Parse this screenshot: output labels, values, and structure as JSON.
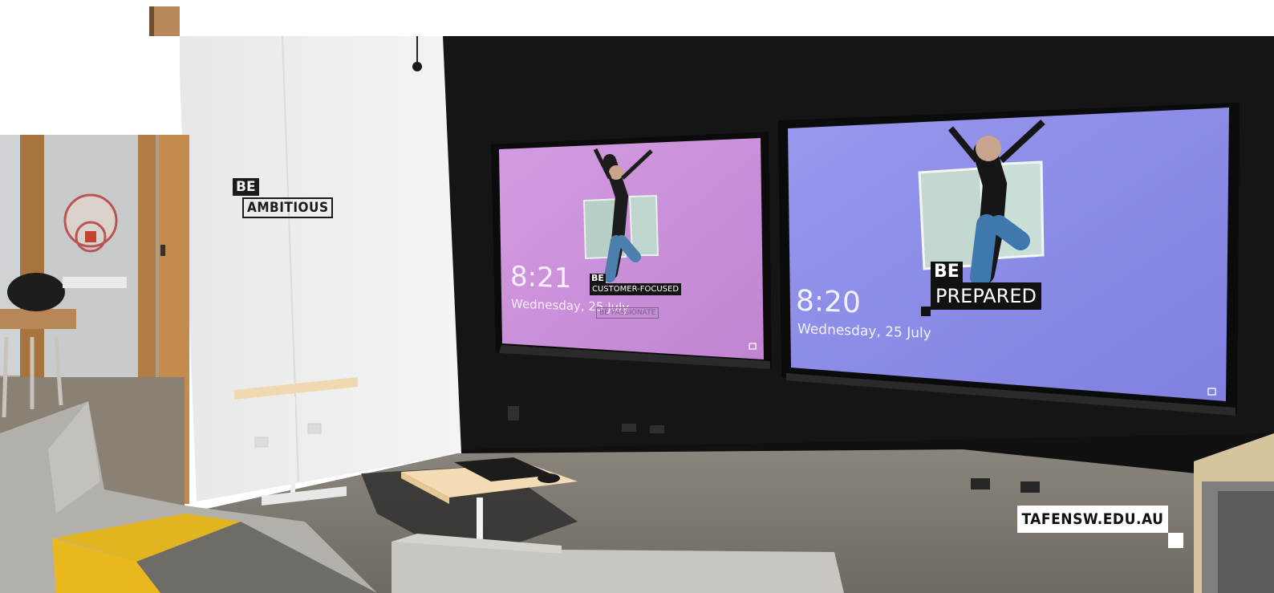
{
  "wall_sign": {
    "line1": "BE",
    "line2": "AMBITIOUS"
  },
  "left_screen": {
    "time": "8:21",
    "date": "Wednesday, 25 July",
    "tag_be": "BE",
    "tag_value": "CUSTOMER-FOCUSED",
    "tag_secondary": "BE PASSIONATE",
    "background_color": "#c98ad6"
  },
  "right_screen": {
    "time": "8:20",
    "date": "Wednesday, 25 July",
    "tag_be": "BE",
    "tag_value": "PREPARED",
    "background_color": "#8b8be6"
  },
  "brand_badge": {
    "text": "TAFENSW.EDU.AU"
  },
  "colors": {
    "wall_dark": "#141414",
    "wall_white": "#eeeeee",
    "floor": "#7c7870",
    "accent_yellow": "#e9b81c"
  }
}
